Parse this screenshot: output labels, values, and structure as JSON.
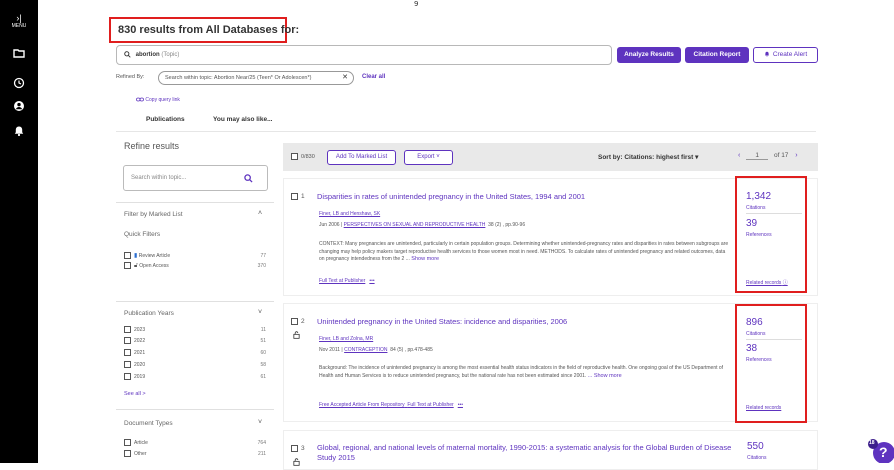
{
  "sidebar": {
    "menu_label": "MENU",
    "menu_arrow": "›|"
  },
  "top_stub": "9",
  "header": {
    "results_title": "830 results from All Databases for:"
  },
  "search": {
    "term": "abortion",
    "field": "(Topic)"
  },
  "buttons": {
    "analyze": "Analyze Results",
    "citation_report": "Citation Report",
    "create_alert": "Create Alert"
  },
  "refined": {
    "label": "Refined By:",
    "chip": "Search within topic: Abortion Near/25 (Teen* Or Adolescen*)",
    "chip_close": "✕",
    "clear_all": "Clear all"
  },
  "copy_query": "Copy query link",
  "tabs": [
    "Publications",
    "You may also like..."
  ],
  "refine": {
    "title": "Refine results",
    "search_placeholder": "Search within topic...",
    "marked_list": "Filter by Marked List",
    "quick_filters": "Quick Filters",
    "quick_items": [
      {
        "label": "Review Article",
        "count": "77"
      },
      {
        "label": "Open Access",
        "count": "370"
      }
    ],
    "pub_years_title": "Publication Years",
    "years": [
      {
        "label": "2023",
        "count": "11"
      },
      {
        "label": "2022",
        "count": "51"
      },
      {
        "label": "2021",
        "count": "60"
      },
      {
        "label": "2020",
        "count": "58"
      },
      {
        "label": "2019",
        "count": "61"
      }
    ],
    "see_all": "See all >",
    "doc_types_title": "Document Types",
    "doc_types": [
      {
        "label": "Article",
        "count": "764"
      },
      {
        "label": "Other",
        "count": "211"
      }
    ]
  },
  "toolbar": {
    "count": "0/830",
    "add_marked": "Add To Marked List",
    "export": "Export",
    "sort": "Sort by: Citations: highest first",
    "page": "1",
    "of_pages": "of 17"
  },
  "records": [
    {
      "index": "1",
      "title": "Disparities in rates of unintended pregnancy in the United States, 1994 and 2001",
      "authors": "Finer, LB and Henshaw, SK",
      "date": "Jun 2006 |",
      "source": "PERSPECTIVES ON SEXUAL AND REPRODUCTIVE HEALTH",
      "pages": "38 (2) , pp.90-96",
      "abstract": "CONTEXT: Many pregnancies are unintended, particularly in certain population groups. Determining whether unintended-pregnancy rates and disparities in rates between subgroups are changing may help policy makers target reproductive health services to those women most in need. METHODS. To calculate rates of unintended pregnancy and related outcomes, data on pregnancy intendedness from the 2 ...",
      "show_more": "Show more",
      "full_text": "Full Text at Publisher",
      "more_dots": "•••",
      "citations": "1,342",
      "citations_label": "Citations",
      "references": "39",
      "references_label": "References",
      "related": "Related records"
    },
    {
      "index": "2",
      "title": "Unintended pregnancy in the United States: incidence and disparities, 2006",
      "authors": "Finer, LB and Zolna, MR",
      "date": "Nov 2011 |",
      "source": "CONTRACEPTION",
      "pages": "84 (5) , pp.478-485",
      "abstract": "Background: The incidence of unintended pregnancy is among the most essential health status indicators in the field of reproductive health. One ongoing goal of the US Department of Health and Human Services is to reduce unintended pregnancy, but the national rate has not been estimated since 2001.",
      "show_more": "... Show more",
      "full_text": "Free Accepted Article From Repository",
      "full_text_2": "Full Text at Publisher",
      "more_dots": "•••",
      "citations": "896",
      "citations_label": "Citations",
      "references": "38",
      "references_label": "References",
      "related": "Related records"
    },
    {
      "index": "3",
      "title": "Global, regional, and national levels of maternal mortality, 1990-2015: a systematic analysis for the Global Burden of Disease Study 2015",
      "citations": "550",
      "citations_label": "Citations"
    }
  ],
  "help": {
    "badge": "18",
    "glyph": "?"
  },
  "colors": {
    "accent": "#5e33bf",
    "highlight_border": "#e01e1e",
    "sidebar": "#000000"
  }
}
